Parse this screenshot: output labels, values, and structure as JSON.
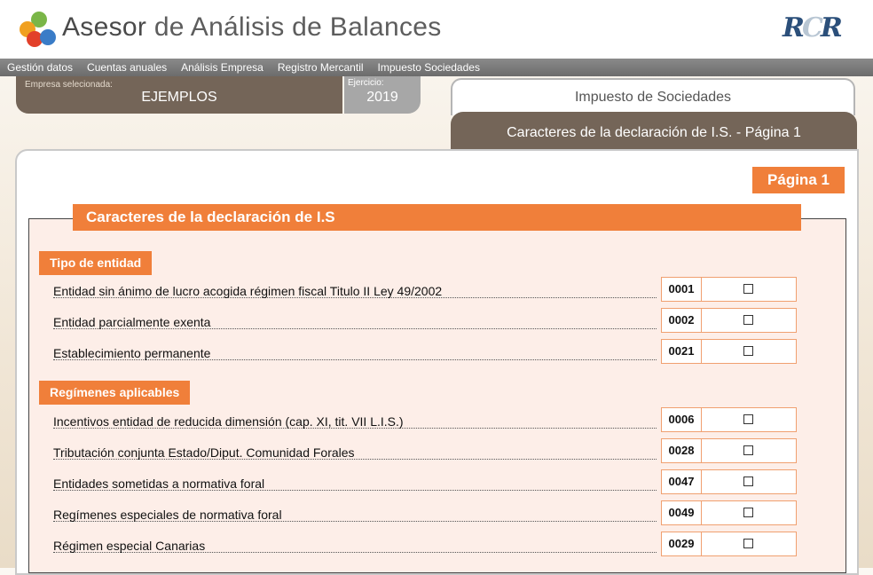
{
  "header": {
    "title_part1": "Asesor",
    "title_part2": "de Análisis de Balances",
    "brand": "RCR"
  },
  "menu": [
    "Gestión datos",
    "Cuentas anuales",
    "Análisis Empresa",
    "Registro Mercantil",
    "Impuesto Sociedades"
  ],
  "company": {
    "label": "Empresa selecionada:",
    "value": "EJEMPLOS"
  },
  "exercise": {
    "label": "Ejercicio:",
    "value": "2019"
  },
  "tabs": {
    "top": "Impuesto de Sociedades",
    "active": "Caracteres de la declaración de I.S. - Página 1"
  },
  "page_badge": "Página 1",
  "form_title": "Caracteres de la declaración de I.S",
  "sections": {
    "tipo": "Tipo de entidad",
    "regimenes": "Regímenes aplicables"
  },
  "rows": [
    {
      "label": "Entidad sin ánimo de lucro acogida régimen fiscal Titulo II Ley 49/2002",
      "code": "0001",
      "checked": false
    },
    {
      "label": "Entidad parcialmente exenta",
      "code": "0002",
      "checked": false
    },
    {
      "label": "Establecimiento permanente",
      "code": "0021",
      "checked": false
    },
    {
      "label": "Incentivos entidad de reducida dimensión (cap. XI, tit. VII L.I.S.)",
      "code": "0006",
      "checked": false
    },
    {
      "label": "Tributación conjunta Estado/Diput. Comunidad Forales",
      "code": "0028",
      "checked": false
    },
    {
      "label": "Entidades sometidas a normativa foral",
      "code": "0047",
      "checked": false
    },
    {
      "label": "Regímenes especiales de normativa foral",
      "code": "0049",
      "checked": false
    },
    {
      "label": "Régimen especial Canarias",
      "code": "0029",
      "checked": false
    }
  ]
}
